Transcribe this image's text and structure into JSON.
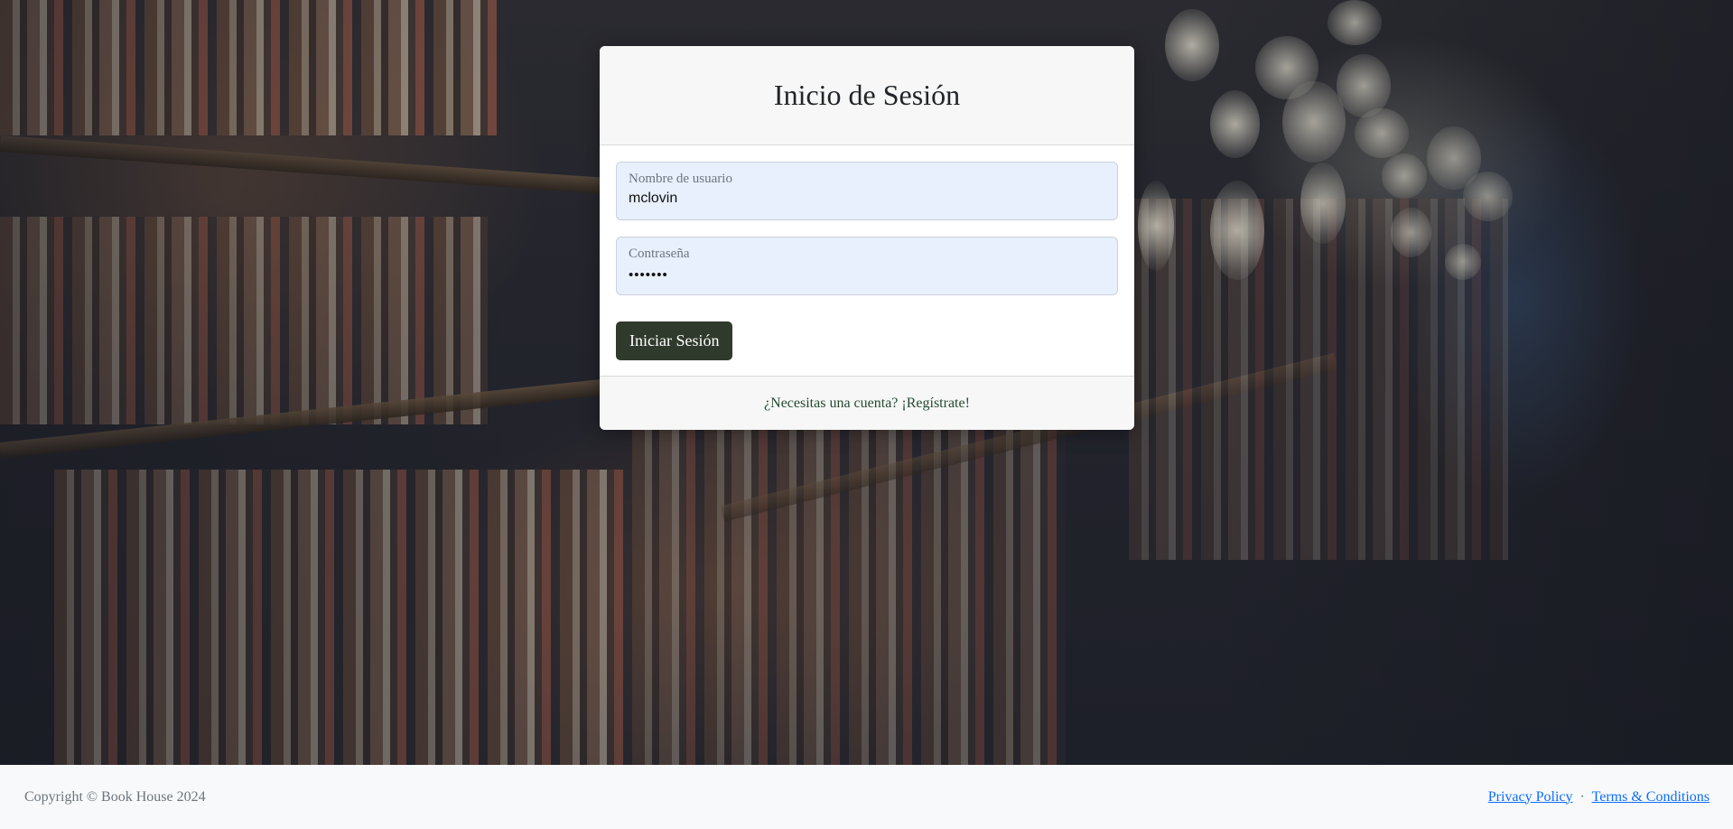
{
  "login": {
    "title": "Inicio de Sesión",
    "username": {
      "label": "Nombre de usuario",
      "value": "mclovin"
    },
    "password": {
      "label": "Contraseña",
      "value": "•••••••"
    },
    "submit_label": "Iniciar Sesión",
    "register_link": "¿Necesitas una cuenta? ¡Regístrate!"
  },
  "footer": {
    "copyright": "Copyright © Book House 2024",
    "privacy_link": "Privacy Policy",
    "separator": "·",
    "terms_link": "Terms & Conditions"
  },
  "colors": {
    "button_bg": "#2f3a2c",
    "input_bg": "#e8f0fe",
    "link": "#0d6efd"
  }
}
